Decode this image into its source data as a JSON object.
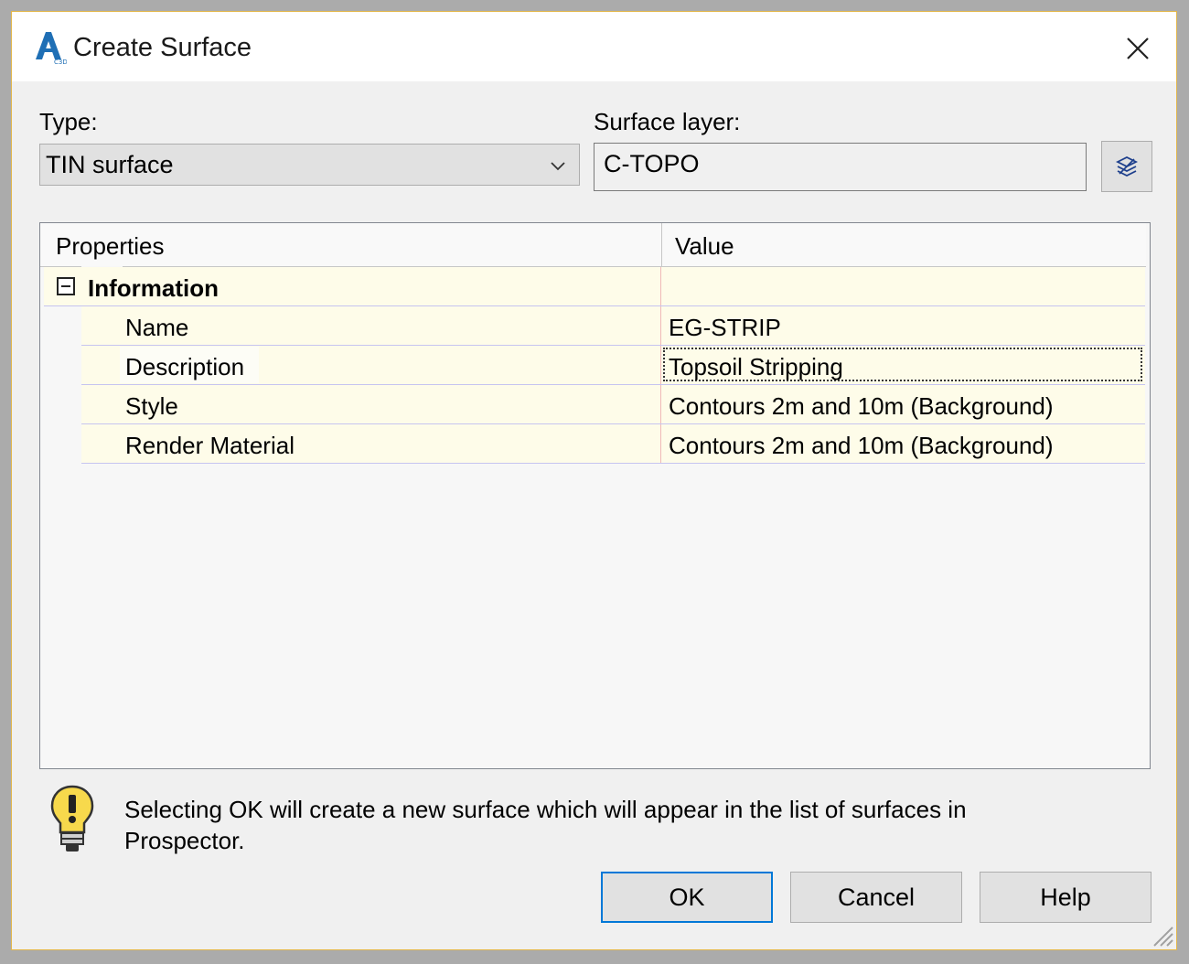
{
  "window": {
    "title": "Create Surface"
  },
  "type_field": {
    "label": "Type:",
    "value": "TIN surface"
  },
  "layer_field": {
    "label": "Surface layer:",
    "value": "C-TOPO"
  },
  "grid": {
    "headers": [
      "Properties",
      "Value"
    ],
    "section": {
      "label": "Information",
      "expanded": true
    },
    "rows": [
      {
        "property": "Name",
        "value": "EG-STRIP"
      },
      {
        "property": "Description",
        "value": "Topsoil Stripping"
      },
      {
        "property": "Style",
        "value": "Contours 2m and 10m (Background)"
      },
      {
        "property": "Render Material",
        "value": "Contours 2m and 10m (Background)"
      }
    ]
  },
  "info": {
    "message": "Selecting OK will create a new surface which will appear in the list of surfaces in Prospector."
  },
  "buttons": {
    "ok": "OK",
    "cancel": "Cancel",
    "help": "Help"
  },
  "colors": {
    "accent": "#0078d7",
    "row_bg": "#fefce9",
    "bulb": "#f7d94c",
    "app_icon": "#1f6fb5"
  }
}
